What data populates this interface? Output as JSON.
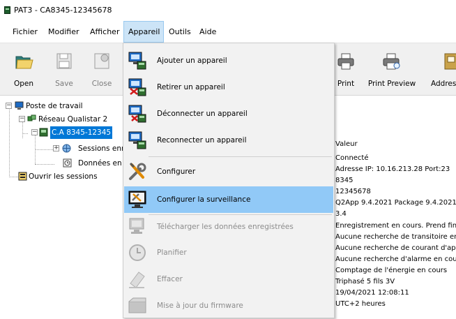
{
  "window": {
    "title": "PAT3 - CA8345-12345678"
  },
  "menubar": {
    "items": [
      "Fichier",
      "Modifier",
      "Afficher",
      "Appareil",
      "Outils",
      "Aide"
    ]
  },
  "toolbar": {
    "open": "Open",
    "save": "Save",
    "close": "Close",
    "print": "Print",
    "print_preview": "Print Preview",
    "address": "Addres"
  },
  "tree": {
    "root": "Poste de travail",
    "network": "Réseau Qualistar 2",
    "device": "C.A 8345-12345",
    "sessions": "Sessions enr",
    "data": "Données en",
    "open_sessions": "Ouvrir les sessions"
  },
  "values": {
    "header": "Valeur",
    "rows": [
      "Connecté",
      "Adresse IP: 10.16.213.28 Port:23",
      "8345",
      "12345678",
      "Q2App 9.4.2021 Package 9.4.2021",
      "3.4",
      "Enregistrement en cours. Prend fin:",
      "Aucune recherche de transitoire en",
      "Aucune recherche de courant d'appe",
      "Aucune recherche d'alarme en cours",
      "Comptage de l'énergie en cours",
      "Triphasé 5 fils 3V",
      "19/04/2021 12:08:11",
      "UTC+2 heures"
    ]
  },
  "dropdown": {
    "add_device": "Ajouter un appareil",
    "remove_device": "Retirer un appareil",
    "disconnect_device": "Déconnecter un appareil",
    "reconnect_device": "Reconnecter un appareil",
    "configure": "Configurer",
    "configure_monitoring": "Configurer la surveillance",
    "download_data": "Télécharger les données enregistrées",
    "schedule": "Planifier",
    "erase": "Effacer",
    "update_firmware": "Mise à jour du firmware"
  },
  "colors": {
    "highlight": "#91c9f7",
    "menu_active": "#cce4f7",
    "tree_selection": "#0078d7"
  }
}
